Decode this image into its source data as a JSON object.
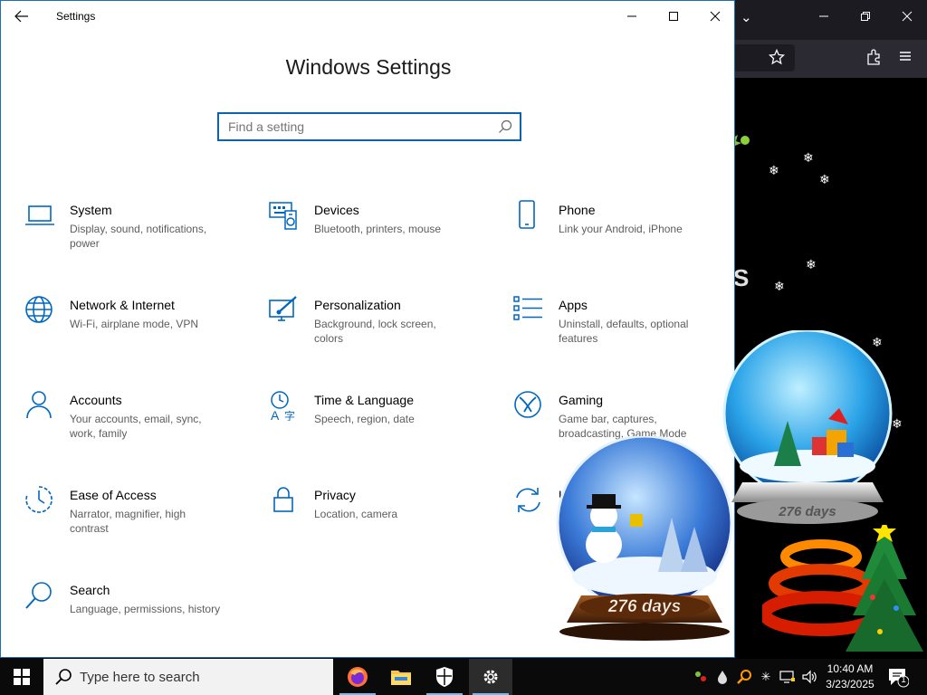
{
  "window": {
    "title": "Settings",
    "heading": "Windows Settings",
    "search_placeholder": "Find a setting"
  },
  "categories": [
    {
      "title": "System",
      "desc": "Display, sound, notifications, power",
      "icon": "laptop-icon"
    },
    {
      "title": "Devices",
      "desc": "Bluetooth, printers, mouse",
      "icon": "keyboard-icon"
    },
    {
      "title": "Phone",
      "desc": "Link your Android, iPhone",
      "icon": "phone-icon"
    },
    {
      "title": "Network & Internet",
      "desc": "Wi-Fi, airplane mode, VPN",
      "icon": "globe-icon"
    },
    {
      "title": "Personalization",
      "desc": "Background, lock screen, colors",
      "icon": "brush-icon"
    },
    {
      "title": "Apps",
      "desc": "Uninstall, defaults, optional features",
      "icon": "apps-list-icon"
    },
    {
      "title": "Accounts",
      "desc": "Your accounts, email, sync, work, family",
      "icon": "person-icon"
    },
    {
      "title": "Time & Language",
      "desc": "Speech, region, date",
      "icon": "time-language-icon"
    },
    {
      "title": "Gaming",
      "desc": "Game bar, captures, broadcasting, Game Mode",
      "icon": "xbox-icon"
    },
    {
      "title": "Ease of Access",
      "desc": "Narrator, magnifier, high contrast",
      "icon": "ease-of-access-icon"
    },
    {
      "title": "Privacy",
      "desc": "Location, camera",
      "icon": "lock-icon"
    },
    {
      "title": "U",
      "desc": "",
      "icon": "update-icon"
    },
    {
      "title": "Search",
      "desc": "Language, permissions, history",
      "icon": "search-icon"
    }
  ],
  "taskbar": {
    "search_text": "Type here to search",
    "time": "10:40 AM",
    "date": "3/23/2025",
    "notification_count": "1",
    "apps": [
      "firefox-icon",
      "file-explorer-icon",
      "windows-security-icon",
      "settings-icon"
    ]
  },
  "globes": {
    "left_label": "276 days",
    "right_label": "276 days"
  },
  "background_text": "S",
  "colors": {
    "accent": "#0a64ad",
    "icon": "#0067c0",
    "taskbar": "#0a0a0a",
    "browser_bar": "#1c1b22"
  }
}
